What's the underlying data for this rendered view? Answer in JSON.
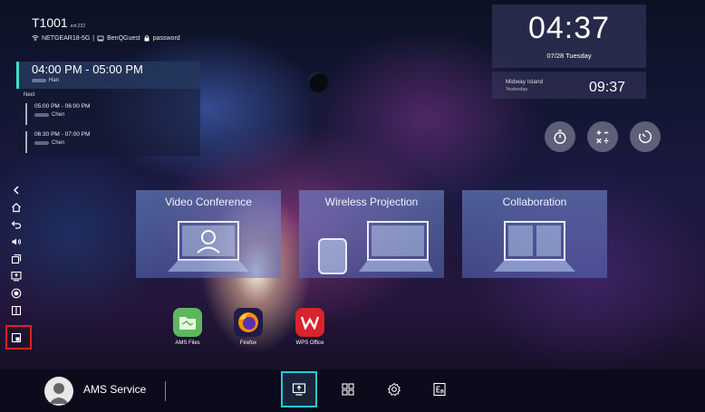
{
  "room": {
    "name": "T1001",
    "ext": "ext.232"
  },
  "network": {
    "wifi_ssid": "NETGEAR18-5G",
    "guest_ssid": "BenQGuest",
    "password": "password"
  },
  "schedule": {
    "current": {
      "time": "04:00 PM - 05:00 PM",
      "host": "Han"
    },
    "next_label": "Next",
    "upcoming": [
      {
        "time": "05:00 PM - 06:00 PM",
        "host": "Chen"
      },
      {
        "time": "06:30 PM - 07:00 PM",
        "host": "Chen"
      }
    ]
  },
  "clock": {
    "time": "04:37",
    "date": "07/28 Tuesday"
  },
  "world_clock": {
    "city": "Midway Island",
    "day": "Yesterday",
    "time": "09:37"
  },
  "tools": [
    "stopwatch-icon",
    "calculator-icon",
    "timer-icon"
  ],
  "sidebar": [
    "collapse-icon",
    "home-icon",
    "back-icon",
    "volume-icon",
    "multitask-icon",
    "screen-share-icon",
    "record-icon",
    "split-screen-icon",
    "window-icon"
  ],
  "cards": [
    {
      "title": "Video Conference"
    },
    {
      "title": "Wireless Projection"
    },
    {
      "title": "Collaboration"
    }
  ],
  "apps": [
    {
      "label": "AMS Files",
      "color": "#4caf50"
    },
    {
      "label": "Firefox",
      "color": "#ff7a00"
    },
    {
      "label": "WPS Office",
      "color": "#d9232d"
    }
  ],
  "bottom": {
    "user": "AMS Service"
  },
  "accent": "#27c8d8"
}
